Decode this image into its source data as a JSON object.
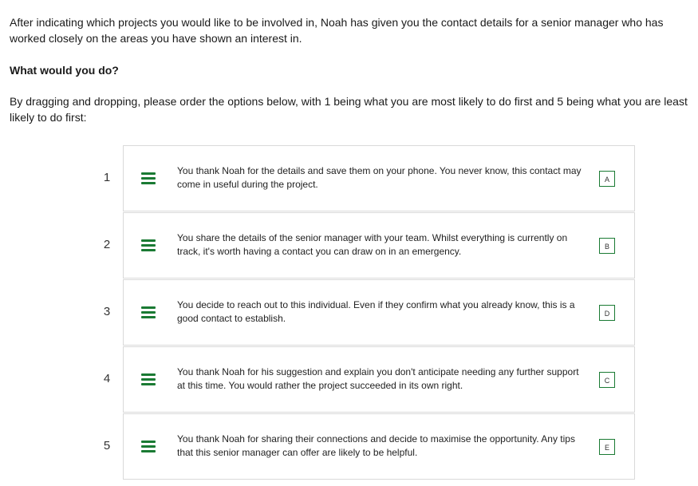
{
  "intro": "After indicating which projects you would like to be involved in, Noah has given you the contact details for a senior manager who has worked closely on the areas you have shown an interest in.",
  "question": "What would you do?",
  "instructions": "By dragging and dropping, please order the options below, with 1 being what you are most likely to do first and 5 being what you are least likely to do first:",
  "accent_color": "#1a7a33",
  "handle_icon": "drag-handle-icon",
  "options": [
    {
      "rank": "1",
      "text": "You thank Noah for the details and save them on your phone. You never know, this contact may come in useful during the project.",
      "letter": "A"
    },
    {
      "rank": "2",
      "text": "You share the details of the senior manager with your team. Whilst everything is currently on track, it's worth having a contact you can draw on in an emergency.",
      "letter": "B"
    },
    {
      "rank": "3",
      "text": "You decide to reach out to this individual. Even if they confirm what you already know, this is a good contact to establish.",
      "letter": "D"
    },
    {
      "rank": "4",
      "text": "You thank Noah for his suggestion and explain you don't anticipate needing any further support at this time. You would rather the project succeeded in its own right.",
      "letter": "C"
    },
    {
      "rank": "5",
      "text": "You thank Noah for sharing their connections and decide to maximise the opportunity. Any tips that this senior manager can offer are likely to be helpful.",
      "letter": "E"
    }
  ]
}
